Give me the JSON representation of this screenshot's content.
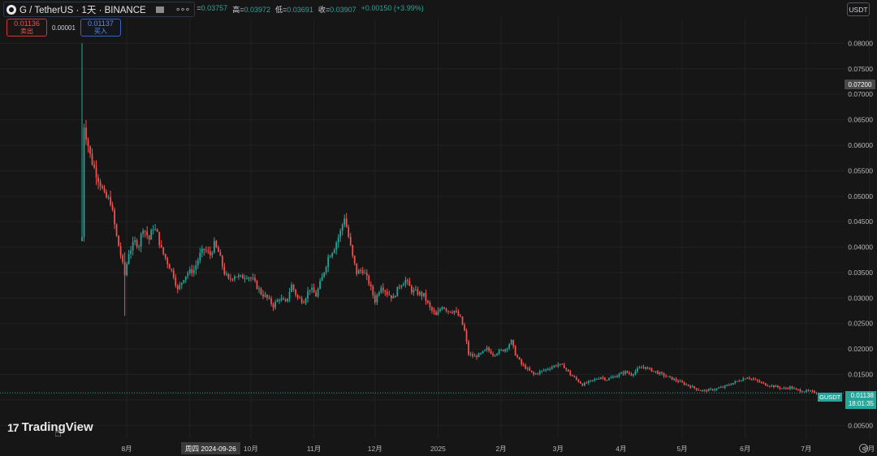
{
  "legend": {
    "symbol": "G / TetherUS · 1天 · BINANCE",
    "more": "∘∘∘",
    "ohlc": [
      {
        "k": "=",
        "v": "0.03757"
      },
      {
        "k": "高=",
        "v": "0.03972"
      },
      {
        "k": "低=",
        "v": "0.03691"
      },
      {
        "k": "收=",
        "v": "0.03907"
      },
      {
        "k": "",
        "v": "+0.00150 (+3.99%)"
      }
    ]
  },
  "trade": {
    "sell_price": "0.01136",
    "sell_label": "卖出",
    "spread": "0.00001",
    "buy_price": "0.01137",
    "buy_label": "买入"
  },
  "currency_button": "USDT",
  "crosshair_price": "0.07200",
  "last_price": {
    "symbol": "GUSDT",
    "price": "0.01138",
    "countdown": "18:01:35"
  },
  "crosshair_date": "周四 2024-09-26",
  "brand": "TradingView",
  "colors": {
    "up": "#26a69a",
    "down": "#ef5350",
    "background": "#161616",
    "grid": "#222222"
  },
  "icons": [
    "symbol-logo-icon",
    "market-status-icon",
    "more-icon",
    "tradingview-logo-icon",
    "settings-gear-icon",
    "cursor-hand-icon"
  ],
  "chart_data": {
    "type": "candlestick",
    "title": "G / TetherUS · 1天 · BINANCE",
    "xlabel": "",
    "ylabel": "",
    "ylim": [
      0.0025,
      0.085
    ],
    "y_ticks": [
      "0.08000",
      "0.07500",
      "0.07000",
      "0.06500",
      "0.06000",
      "0.05500",
      "0.05000",
      "0.04500",
      "0.04000",
      "0.03500",
      "0.03000",
      "0.02500",
      "0.02000",
      "0.01500",
      "0.01000",
      "0.00500"
    ],
    "x_ticks": [
      "8月",
      "9月",
      "10月",
      "11月",
      "12月",
      "2025",
      "2月",
      "3月",
      "4月",
      "5月",
      "6月",
      "7月",
      "8月"
    ],
    "x_tick_day": [
      10,
      41,
      71,
      102,
      132,
      163,
      194,
      222,
      253,
      283,
      314,
      344,
      375
    ],
    "first_candle_day": 0,
    "total_days": 402,
    "series": [
      {
        "segments": [
          [
            0,
            0.042
          ],
          [
            1,
            0.064
          ],
          [
            4,
            0.058
          ],
          [
            6,
            0.0555
          ],
          [
            9,
            0.0525
          ],
          [
            11,
            0.05
          ],
          [
            14,
            0.049
          ],
          [
            17,
            0.042
          ],
          [
            19,
            0.0385
          ],
          [
            21,
            0.0345
          ],
          [
            23,
            0.039
          ],
          [
            26,
            0.041
          ],
          [
            28,
            0.0405
          ],
          [
            30,
            0.044
          ],
          [
            33,
            0.0415
          ],
          [
            35,
            0.044
          ],
          [
            37,
            0.0425
          ],
          [
            39,
            0.0395
          ],
          [
            42,
            0.037
          ],
          [
            45,
            0.0345
          ],
          [
            47,
            0.0315
          ],
          [
            50,
            0.034
          ],
          [
            52,
            0.035
          ],
          [
            55,
            0.0355
          ],
          [
            58,
            0.0385
          ],
          [
            60,
            0.0395
          ],
          [
            63,
            0.0385
          ],
          [
            65,
            0.0405
          ],
          [
            67,
            0.039
          ],
          [
            70,
            0.035
          ],
          [
            72,
            0.0335
          ],
          [
            75,
            0.0345
          ],
          [
            78,
            0.034
          ],
          [
            81,
            0.0345
          ],
          [
            84,
            0.0335
          ],
          [
            88,
            0.031
          ],
          [
            91,
            0.03
          ],
          [
            94,
            0.0285
          ],
          [
            97,
            0.03
          ],
          [
            100,
            0.029
          ],
          [
            103,
            0.0325
          ],
          [
            106,
            0.03
          ],
          [
            109,
            0.0295
          ],
          [
            112,
            0.032
          ],
          [
            115,
            0.0305
          ],
          [
            118,
            0.034
          ],
          [
            121,
            0.038
          ],
          [
            124,
            0.04
          ],
          [
            127,
            0.043
          ],
          [
            129,
            0.046
          ],
          [
            131,
            0.042
          ],
          [
            133,
            0.038
          ],
          [
            135,
            0.035
          ],
          [
            138,
            0.0355
          ],
          [
            141,
            0.033
          ],
          [
            144,
            0.0295
          ],
          [
            147,
            0.0325
          ],
          [
            150,
            0.031
          ],
          [
            153,
            0.03
          ],
          [
            156,
            0.0325
          ],
          [
            159,
            0.0335
          ],
          [
            162,
            0.0315
          ],
          [
            165,
            0.031
          ],
          [
            168,
            0.0305
          ],
          [
            171,
            0.028
          ],
          [
            174,
            0.0265
          ],
          [
            177,
            0.0285
          ],
          [
            180,
            0.0275
          ],
          [
            183,
            0.0275
          ],
          [
            186,
            0.026
          ],
          [
            188,
            0.0235
          ],
          [
            190,
            0.019
          ],
          [
            193,
            0.0185
          ],
          [
            196,
            0.019
          ],
          [
            199,
            0.02
          ],
          [
            202,
            0.019
          ],
          [
            205,
            0.0195
          ],
          [
            208,
            0.02
          ],
          [
            211,
            0.0215
          ],
          [
            213,
            0.019
          ],
          [
            216,
            0.017
          ],
          [
            219,
            0.016
          ],
          [
            222,
            0.015
          ],
          [
            225,
            0.0155
          ],
          [
            228,
            0.016
          ],
          [
            231,
            0.0165
          ],
          [
            234,
            0.017
          ],
          [
            237,
            0.0165
          ],
          [
            240,
            0.015
          ],
          [
            243,
            0.014
          ],
          [
            246,
            0.013
          ],
          [
            249,
            0.0135
          ],
          [
            252,
            0.014
          ],
          [
            255,
            0.0145
          ],
          [
            258,
            0.014
          ],
          [
            261,
            0.0145
          ],
          [
            264,
            0.015
          ],
          [
            267,
            0.0155
          ],
          [
            270,
            0.015
          ],
          [
            273,
            0.016
          ],
          [
            276,
            0.0165
          ],
          [
            279,
            0.016
          ],
          [
            282,
            0.0155
          ],
          [
            285,
            0.015
          ],
          [
            288,
            0.0145
          ],
          [
            291,
            0.014
          ],
          [
            294,
            0.0135
          ],
          [
            297,
            0.013
          ],
          [
            300,
            0.0125
          ],
          [
            303,
            0.012
          ],
          [
            306,
            0.0118
          ],
          [
            309,
            0.012
          ],
          [
            312,
            0.0122
          ],
          [
            315,
            0.0125
          ],
          [
            318,
            0.013
          ],
          [
            321,
            0.0135
          ],
          [
            324,
            0.014
          ],
          [
            327,
            0.0145
          ],
          [
            330,
            0.014
          ],
          [
            333,
            0.0135
          ],
          [
            336,
            0.013
          ],
          [
            339,
            0.0128
          ],
          [
            342,
            0.0125
          ],
          [
            345,
            0.0122
          ],
          [
            348,
            0.0125
          ],
          [
            351,
            0.012
          ],
          [
            354,
            0.0118
          ],
          [
            357,
            0.0117
          ],
          [
            360,
            0.0115
          ],
          [
            362,
            0.0114
          ]
        ]
      }
    ],
    "wick_extremes": [
      {
        "day": 0,
        "high": 0.08,
        "low": 0.042
      },
      {
        "day": 21,
        "high": 0.039,
        "low": 0.0265
      }
    ]
  }
}
